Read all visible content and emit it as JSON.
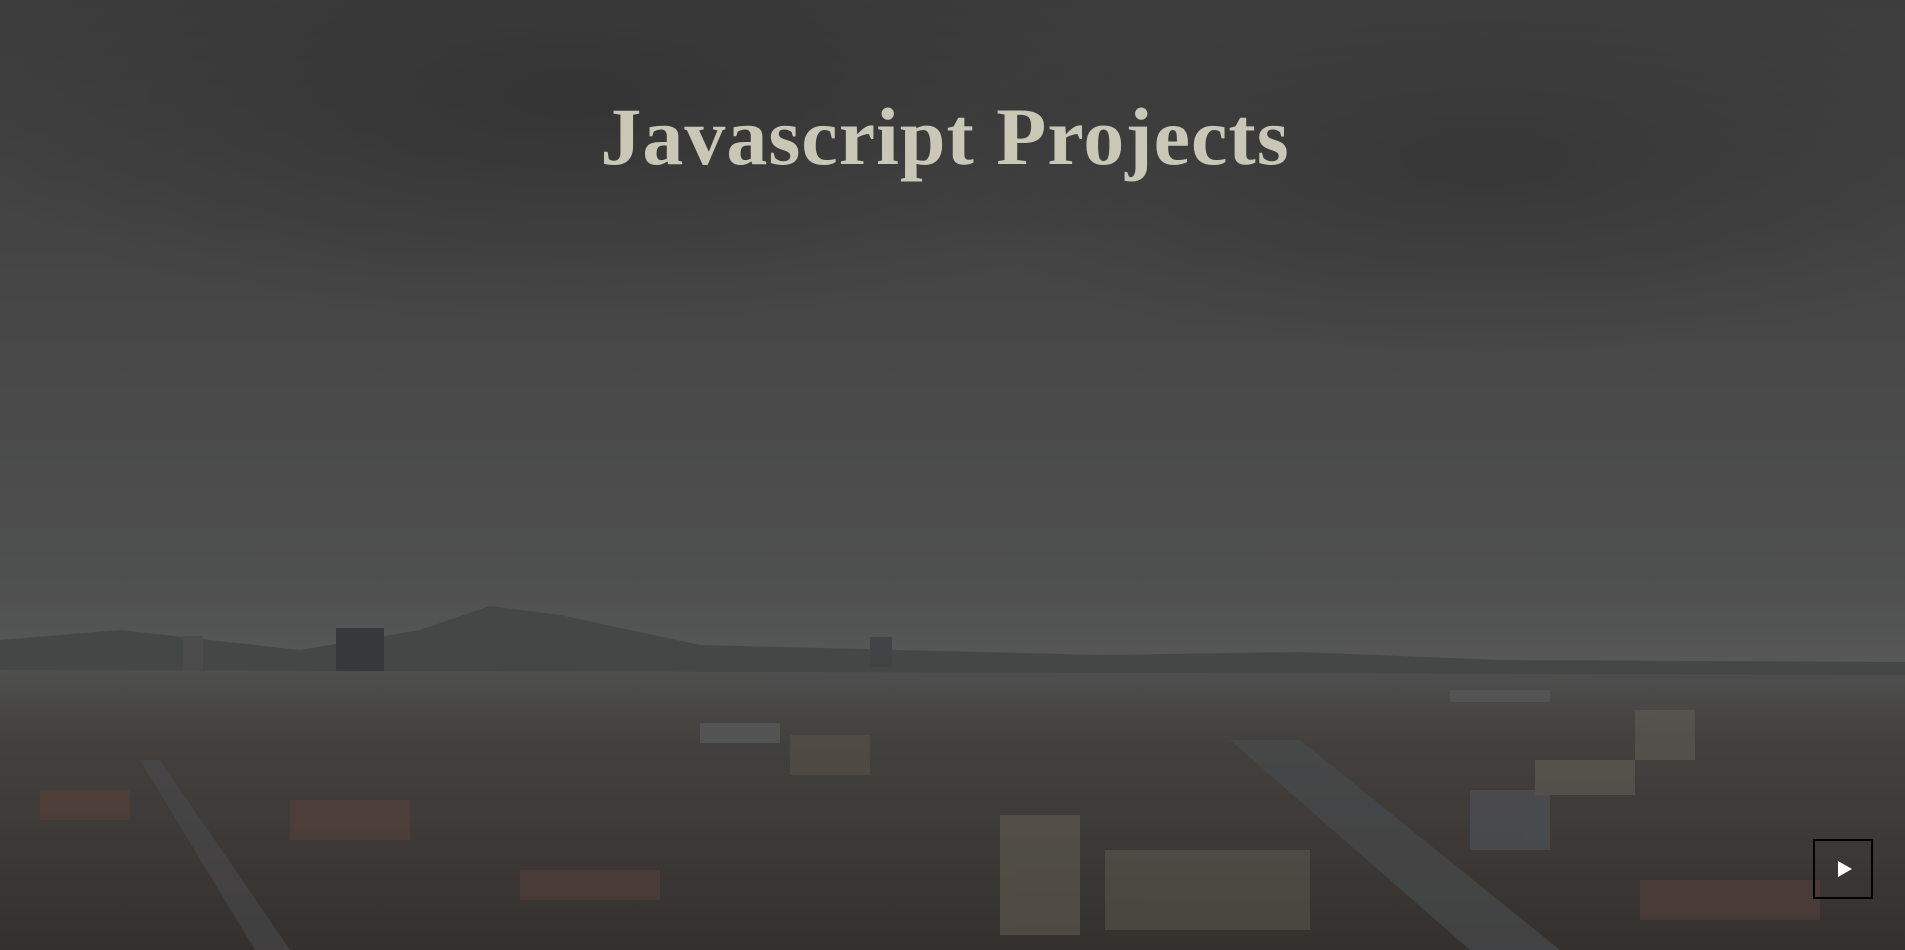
{
  "page": {
    "title": "Javascript Projects"
  },
  "video_background": {
    "description_icon": "city-skyline-video",
    "colors": {
      "sky_top": "#4a4a4a",
      "sky_mid": "#5c5c5c",
      "horizon": "#6a6b6b",
      "city": "#4b4640"
    }
  },
  "controls": {
    "play_icon": "play-icon",
    "play_button_border": "#000000",
    "play_icon_color": "#ffffff"
  },
  "title_color": "#c9c8b6"
}
